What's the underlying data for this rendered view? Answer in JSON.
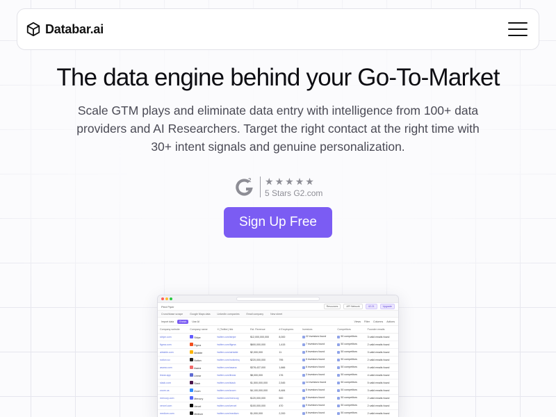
{
  "nav": {
    "brand": "Databar.ai",
    "logo_icon": "cube-icon",
    "menu_icon": "hamburger-icon"
  },
  "hero": {
    "title": "The data engine behind your Go-To-Market",
    "subtitle": "Scale GTM plays and eliminate data entry with intelligence from 100+ data providers and AI Researchers. Target the right contact at the right time with 30+ intent signals and genuine personalization."
  },
  "rating": {
    "badge_icon": "g2-logo-icon",
    "stars": 5,
    "text": "5 Stars G2.com"
  },
  "cta": {
    "label": "Sign Up Free"
  },
  "colors": {
    "accent": "#7b5cf3",
    "text": "#0d0d12",
    "muted": "#4a4a55"
  },
  "preview": {
    "app_name": "Pied Piper",
    "top_chips": [
      "Resources",
      "API Network",
      "42.21",
      "Upgrade"
    ],
    "tabs": [
      "Crunchbase scrape",
      "Google Maps data",
      "LinkedIn companies",
      "Email company",
      "New sheet"
    ],
    "tools": [
      "Import data",
      "Enrich",
      "Use AI",
      "Views",
      "Filter",
      "Columns",
      "Actions"
    ],
    "columns": [
      "Company website",
      "Company name",
      "X (Twitter) link",
      "Est. Revenue",
      "# Employees",
      "Investors",
      "Competitors",
      "Founder emails"
    ],
    "rows": [
      {
        "site": "stripe.com",
        "name": "Stripe",
        "color": "#635bff",
        "x": "twitter.com/stripe",
        "rev": "$12,000,000,000",
        "emp": "8,000",
        "inv": "22 investors found",
        "comp": "50 competitors",
        "emails": "3 valid emails found"
      },
      {
        "site": "figma.com",
        "name": "Figma",
        "color": "#f24e1e",
        "x": "twitter.com/figma",
        "rev": "$600,000,000",
        "emp": "1,415",
        "inv": "7 investors found",
        "comp": "50 competitors",
        "emails": "2 valid emails found"
      },
      {
        "site": "airtable.com",
        "name": "Airtable",
        "color": "#fcb400",
        "x": "twitter.com/airtable",
        "rev": "$2,000,000",
        "emp": "11",
        "inv": "8 investors found",
        "comp": "50 competitors",
        "emails": "3 valid emails found"
      },
      {
        "site": "notion.so",
        "name": "Notion",
        "color": "#222222",
        "x": "twitter.com/notionhq",
        "rev": "$220,000,000",
        "emp": "795",
        "inv": "5 investors found",
        "comp": "50 competitors",
        "emails": "2 valid emails found"
      },
      {
        "site": "asana.com",
        "name": "Asana",
        "color": "#f06a6a",
        "x": "twitter.com/asana",
        "rev": "$378,437,000",
        "emp": "1,666",
        "inv": "6 investors found",
        "comp": "50 competitors",
        "emails": "4 valid emails found"
      },
      {
        "site": "linear.app",
        "name": "Linear",
        "color": "#5e6ad2",
        "x": "twitter.com/linear",
        "rev": "$8,000,000",
        "emp": "176",
        "inv": "3 investors found",
        "comp": "50 competitors",
        "emails": "4 valid emails found"
      },
      {
        "site": "slack.com",
        "name": "Slack",
        "color": "#4a154b",
        "x": "twitter.com/slack",
        "rev": "$1,500,000,000",
        "emp": "2,545",
        "inv": "14 investors found",
        "comp": "50 competitors",
        "emails": "5 valid emails found"
      },
      {
        "site": "zoom.us",
        "name": "Zoom",
        "color": "#2d8cff",
        "x": "twitter.com/zoom",
        "rev": "$4,100,000,000",
        "emp": "8,484",
        "inv": "5 investors found",
        "comp": "50 competitors",
        "emails": "3 valid emails found"
      },
      {
        "site": "mercury.com",
        "name": "Mercury",
        "color": "#5466f9",
        "x": "twitter.com/mercury",
        "rev": "$120,000,000",
        "emp": "500",
        "inv": "9 investors found",
        "comp": "50 competitors",
        "emails": "2 valid emails found"
      },
      {
        "site": "vercel.com",
        "name": "Vercel",
        "color": "#000000",
        "x": "twitter.com/vercel",
        "rev": "$100,000,000",
        "emp": "470",
        "inv": "9 investors found",
        "comp": "50 competitors",
        "emails": "2 valid emails found"
      },
      {
        "site": "medium.com",
        "name": "Medium",
        "color": "#111111",
        "x": "twitter.com/medium",
        "rev": "$1,000,000",
        "emp": "2,200",
        "inv": "6 investors found",
        "comp": "50 competitors",
        "emails": "2 valid emails found"
      }
    ]
  }
}
